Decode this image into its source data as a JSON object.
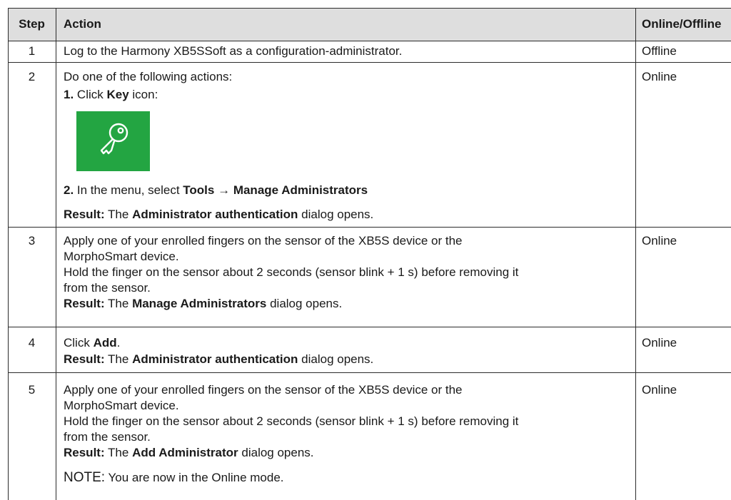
{
  "table": {
    "headers": {
      "step": "Step",
      "action": "Action",
      "mode": "Online/Offline"
    },
    "row1": {
      "step": "1",
      "action": "Log to the Harmony XB5SSoft as a configuration-administrator.",
      "mode": "Offline"
    },
    "row2": {
      "step": "2",
      "intro": "Do one of the following actions:",
      "item1_num": "1.",
      "item1_pre": " Click ",
      "item1_bold": "Key",
      "item1_post": " icon:",
      "icon": "key-icon",
      "icon_bg": "#23a542",
      "item2_num": "2.",
      "item2_pre": " In the menu, select ",
      "item2_bold1": "Tools",
      "item2_arrow": " → ",
      "item2_bold2": "Manage Administrators",
      "result_label": "Result:",
      "result_pre": " The ",
      "result_bold": "Administrator authentication",
      "result_post": " dialog opens.",
      "mode": "Online"
    },
    "row3": {
      "step": "3",
      "line1": "Apply one of your enrolled fingers on the sensor of the XB5S device or the",
      "line2": "MorphoSmart device.",
      "line3": "Hold the finger on the sensor about 2 seconds (sensor blink + 1 s) before removing it",
      "line4": "from the sensor.",
      "result_label": "Result:",
      "result_pre": " The ",
      "result_bold": "Manage Administrators",
      "result_post": " dialog opens.",
      "mode": "Online"
    },
    "row4": {
      "step": "4",
      "click_pre": "Click ",
      "click_bold": "Add",
      "click_post": ".",
      "result_label": "Result:",
      "result_pre": " The ",
      "result_bold": "Administrator authentication",
      "result_post": " dialog opens.",
      "mode": "Online"
    },
    "row5": {
      "step": "5",
      "line1": "Apply one of your enrolled fingers on the sensor of the XB5S device or the",
      "line2": "MorphoSmart device.",
      "line3": "Hold the finger on the sensor about 2 seconds (sensor blink + 1 s) before removing it",
      "line4": "from the sensor.",
      "result_label": "Result:",
      "result_pre": " The ",
      "result_bold": "Add Administrator",
      "result_post": " dialog opens.",
      "note_label": "NOTE:",
      "note_text": " You are now in the Online mode.",
      "mode": "Online"
    }
  }
}
